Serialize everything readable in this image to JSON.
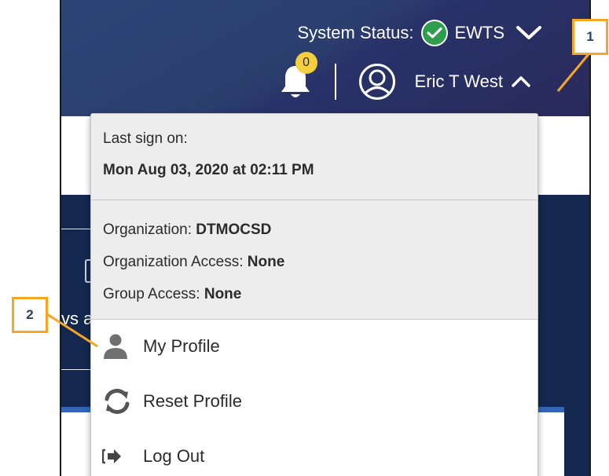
{
  "header": {
    "system_status_label": "System Status:",
    "system_status_value": "EWTS",
    "notification_count": "0",
    "user_name": "Eric T West"
  },
  "background": {
    "partial_text": "vs a"
  },
  "dropdown": {
    "last_sign_on_label": "Last sign on:",
    "last_sign_on_value": "Mon Aug 03, 2020 at 02:11 PM",
    "organization_label": "Organization:",
    "organization_value": "DTMOCSD",
    "organization_access_label": "Organization Access:",
    "organization_access_value": "None",
    "group_access_label": "Group Access:",
    "group_access_value": "None",
    "menu": [
      {
        "label": "My Profile",
        "icon": "user-icon"
      },
      {
        "label": "Reset Profile",
        "icon": "sync-icon"
      },
      {
        "label": "Log Out",
        "icon": "logout-icon"
      }
    ]
  },
  "callouts": {
    "one": "1",
    "two": "2"
  },
  "colors": {
    "header_start": "#2c4476",
    "header_end": "#2a2a5c",
    "status_ok": "#2e9d4d",
    "badge": "#f4d03f",
    "callout_border": "#f5a623",
    "callout_text": "#2a3f6b"
  }
}
